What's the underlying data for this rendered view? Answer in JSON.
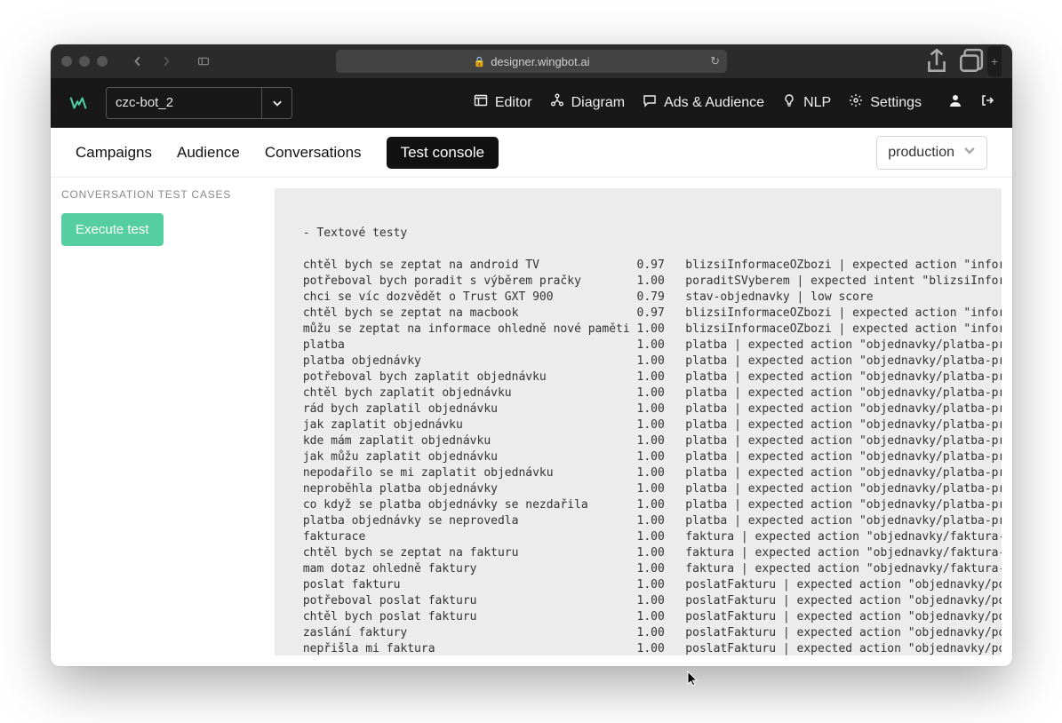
{
  "browser": {
    "address": "designer.wingbot.ai"
  },
  "app": {
    "logo_letter": "w",
    "bot_name": "czc-bot_2",
    "menu": {
      "editor": "Editor",
      "diagram": "Diagram",
      "ads": "Ads & Audience",
      "nlp": "NLP",
      "settings": "Settings"
    }
  },
  "tabs": {
    "campaigns": "Campaigns",
    "audience": "Audience",
    "conversations": "Conversations",
    "test_console": "Test console",
    "environment": "production"
  },
  "sidebar": {
    "title": "CONVERSATION TEST CASES",
    "execute_label": "Execute test"
  },
  "test_output": {
    "header": "- Textové testy",
    "rows": [
      {
        "text": "chtěl bych se zeptat na android TV",
        "score": "0.97",
        "result": "blizsiInformaceOZbozi | expected action \"informace-o-zb"
      },
      {
        "text": "potřeboval bych poradit s výběrem pračky",
        "score": "1.00",
        "result": "poraditSVyberem | expected intent \"blizsiInformaceOZboz"
      },
      {
        "text": "chci se víc dozvědět o Trust GXT 900",
        "score": "0.79",
        "result": "stav-objednavky | low score"
      },
      {
        "text": "chtěl bych se zeptat na macbook",
        "score": "0.97",
        "result": "blizsiInformaceOZbozi | expected action \"informace-o-zb"
      },
      {
        "text": "můžu se zeptat na informace ohledně nové paměti",
        "score": "1.00",
        "result": "blizsiInformaceOZbozi | expected action \"informace-o-zb"
      },
      {
        "text": "platba",
        "score": "1.00",
        "result": "platba | expected action \"objednavky/platba-prihlasen-n"
      },
      {
        "text": "platba objednávky",
        "score": "1.00",
        "result": "platba | expected action \"objednavky/platba-prihlasen-n"
      },
      {
        "text": "potřeboval bych zaplatit objednávku",
        "score": "1.00",
        "result": "platba | expected action \"objednavky/platba-prihlasen-n"
      },
      {
        "text": "chtěl bych zaplatit objednávku",
        "score": "1.00",
        "result": "platba | expected action \"objednavky/platba-prihlasen-n"
      },
      {
        "text": "rád bych zaplatil objednávku",
        "score": "1.00",
        "result": "platba | expected action \"objednavky/platba-prihlasen-n"
      },
      {
        "text": "jak zaplatit objednávku",
        "score": "1.00",
        "result": "platba | expected action \"objednavky/platba-prihlasen-n"
      },
      {
        "text": "kde mám zaplatit objednávku",
        "score": "1.00",
        "result": "platba | expected action \"objednavky/platba-prihlasen-n"
      },
      {
        "text": "jak můžu zaplatit objednávku",
        "score": "1.00",
        "result": "platba | expected action \"objednavky/platba-prihlasen-n"
      },
      {
        "text": "nepodařilo se mi zaplatit objednávku",
        "score": "1.00",
        "result": "platba | expected action \"objednavky/platba-prihlasen-n"
      },
      {
        "text": "neproběhla platba objednávky",
        "score": "1.00",
        "result": "platba | expected action \"objednavky/platba-prihlasen-n"
      },
      {
        "text": "co když se platba objednávky se nezdařila",
        "score": "1.00",
        "result": "platba | expected action \"objednavky/platba-prihlasen-n"
      },
      {
        "text": "platba objednávky se neprovedla",
        "score": "1.00",
        "result": "platba | expected action \"objednavky/platba-prihlasen-n"
      },
      {
        "text": "fakturace",
        "score": "1.00",
        "result": "faktura | expected action \"objednavky/faktura-neprihlas"
      },
      {
        "text": "chtěl bych se zeptat na fakturu",
        "score": "1.00",
        "result": "faktura | expected action \"objednavky/faktura-neprihlas"
      },
      {
        "text": "mam dotaz ohledně faktury",
        "score": "1.00",
        "result": "faktura | expected action \"objednavky/faktura-neprihlas"
      },
      {
        "text": "poslat fakturu",
        "score": "1.00",
        "result": "poslatFakturu | expected action \"objednavky/poslat-fakt"
      },
      {
        "text": "potřeboval poslat fakturu",
        "score": "1.00",
        "result": "poslatFakturu | expected action \"objednavky/poslat-fakt"
      },
      {
        "text": "chtěl bych poslat fakturu",
        "score": "1.00",
        "result": "poslatFakturu | expected action \"objednavky/poslat-fakt"
      },
      {
        "text": "zaslání faktury",
        "score": "1.00",
        "result": "poslatFakturu | expected action \"objednavky/poslat-fakt"
      },
      {
        "text": "nepřišla mi faktura",
        "score": "1.00",
        "result": "poslatFakturu | expected action \"objednavky/poslat-fakt"
      }
    ]
  }
}
